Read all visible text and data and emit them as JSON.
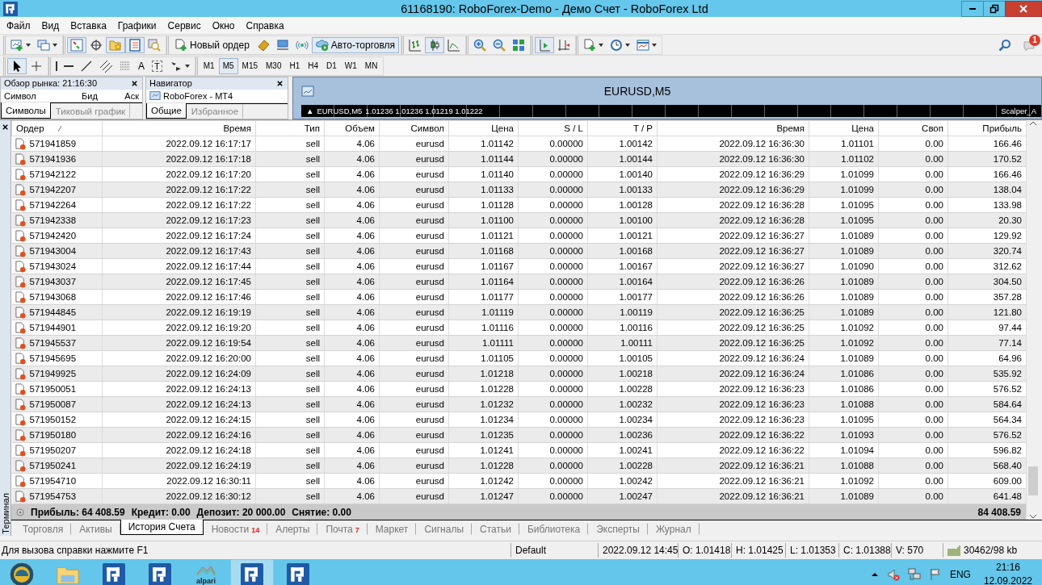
{
  "window": {
    "title": "61168190: RoboForex-Demo - Демо Счет - RoboForex Ltd"
  },
  "menu": [
    "Файл",
    "Вид",
    "Вставка",
    "Графики",
    "Сервис",
    "Окно",
    "Справка"
  ],
  "toolbar": [
    {
      "kind": "new-chart",
      "on": false,
      "dropdown": true
    },
    {
      "kind": "profiles",
      "on": false,
      "dropdown": true
    },
    {
      "kind": "separator"
    },
    {
      "kind": "market-watch",
      "on": true
    },
    {
      "kind": "data-window",
      "on": false
    },
    {
      "kind": "navigator",
      "on": true
    },
    {
      "kind": "terminal",
      "on": true
    },
    {
      "kind": "tester",
      "on": false
    },
    {
      "kind": "separator"
    },
    {
      "kind": "new-order",
      "label": "Новый ордер",
      "on": false
    },
    {
      "kind": "editor",
      "on": false
    },
    {
      "kind": "community",
      "on": false
    },
    {
      "kind": "signals",
      "on": false
    },
    {
      "kind": "autotrading",
      "label": "Авто-торговля",
      "on": true
    },
    {
      "kind": "separator"
    },
    {
      "kind": "bars",
      "on": false
    },
    {
      "kind": "candles",
      "on": true
    },
    {
      "kind": "line",
      "on": false
    },
    {
      "kind": "separator"
    },
    {
      "kind": "zoom-in",
      "on": false
    },
    {
      "kind": "zoom-out",
      "on": false
    },
    {
      "kind": "tile",
      "on": false
    },
    {
      "kind": "separator"
    },
    {
      "kind": "autoscroll",
      "on": true
    },
    {
      "kind": "shift",
      "on": false
    },
    {
      "kind": "separator"
    },
    {
      "kind": "indicators",
      "on": false,
      "dropdown": true
    },
    {
      "kind": "periods",
      "on": false,
      "dropdown": true
    },
    {
      "kind": "templates",
      "on": false,
      "dropdown": true
    }
  ],
  "notifications": {
    "count": "1"
  },
  "drawing_toolbar": [
    {
      "kind": "cursor",
      "on": true
    },
    {
      "kind": "crosshair",
      "on": false
    },
    {
      "kind": "separator"
    },
    {
      "kind": "vertical-line",
      "on": false
    },
    {
      "kind": "horizontal-line",
      "on": false
    },
    {
      "kind": "trend-line",
      "on": false
    },
    {
      "kind": "channel",
      "on": false
    },
    {
      "kind": "fibonacci",
      "on": false
    },
    {
      "kind": "text",
      "label": "A",
      "on": false
    },
    {
      "kind": "text-label",
      "label": "T",
      "on": false
    },
    {
      "kind": "arrows",
      "on": false,
      "dropdown": true
    }
  ],
  "timeframes": [
    {
      "label": "M1",
      "selected": false
    },
    {
      "label": "M5",
      "selected": true
    },
    {
      "label": "M15",
      "selected": false
    },
    {
      "label": "M30",
      "selected": false
    },
    {
      "label": "H1",
      "selected": false
    },
    {
      "label": "H4",
      "selected": false
    },
    {
      "label": "D1",
      "selected": false
    },
    {
      "label": "W1",
      "selected": false
    },
    {
      "label": "MN",
      "selected": false
    }
  ],
  "market_watch": {
    "title": "Обзор рынка: 21:16:30",
    "columns": [
      "Символ",
      "Бид",
      "Аск"
    ],
    "tabs": [
      {
        "label": "Символы",
        "selected": true
      },
      {
        "label": "Тиковый график",
        "selected": false
      }
    ]
  },
  "navigator": {
    "title": "Навигатор",
    "items": [
      {
        "label": "RoboForex - MT4"
      }
    ],
    "tabs": [
      {
        "label": "Общие",
        "selected": true
      },
      {
        "label": "Избранное",
        "selected": false
      }
    ]
  },
  "chart": {
    "title": "EURUSD,M5",
    "marker": "▲",
    "symbol": "EURUSD,M5",
    "ohlc": "1.01236 1.01236 1.01219 1.01222",
    "indicator": "Scalper_A"
  },
  "terminal": {
    "label": "Терминал",
    "columns": [
      "Ордер",
      "Время",
      "Тип",
      "Объем",
      "Символ",
      "Цена",
      "S / L",
      "T / P",
      "Время",
      "Цена",
      "Своп",
      "Прибыль"
    ],
    "rows": [
      {
        "cells": [
          "571941859",
          "2022.09.12 16:17:17",
          "sell",
          "4.06",
          "eurusd",
          "1.01142",
          "0.00000",
          "1.00142",
          "2022.09.12 16:36:30",
          "1.01101",
          "0.00",
          "166.46"
        ]
      },
      {
        "cells": [
          "571941936",
          "2022.09.12 16:17:18",
          "sell",
          "4.06",
          "eurusd",
          "1.01144",
          "0.00000",
          "1.00144",
          "2022.09.12 16:36:30",
          "1.01102",
          "0.00",
          "170.52"
        ]
      },
      {
        "cells": [
          "571942122",
          "2022.09.12 16:17:20",
          "sell",
          "4.06",
          "eurusd",
          "1.01140",
          "0.00000",
          "1.00140",
          "2022.09.12 16:36:29",
          "1.01099",
          "0.00",
          "166.46"
        ]
      },
      {
        "cells": [
          "571942207",
          "2022.09.12 16:17:22",
          "sell",
          "4.06",
          "eurusd",
          "1.01133",
          "0.00000",
          "1.00133",
          "2022.09.12 16:36:29",
          "1.01099",
          "0.00",
          "138.04"
        ]
      },
      {
        "cells": [
          "571942264",
          "2022.09.12 16:17:22",
          "sell",
          "4.06",
          "eurusd",
          "1.01128",
          "0.00000",
          "1.00128",
          "2022.09.12 16:36:28",
          "1.01095",
          "0.00",
          "133.98"
        ]
      },
      {
        "cells": [
          "571942338",
          "2022.09.12 16:17:23",
          "sell",
          "4.06",
          "eurusd",
          "1.01100",
          "0.00000",
          "1.00100",
          "2022.09.12 16:36:28",
          "1.01095",
          "0.00",
          "20.30"
        ]
      },
      {
        "cells": [
          "571942420",
          "2022.09.12 16:17:24",
          "sell",
          "4.06",
          "eurusd",
          "1.01121",
          "0.00000",
          "1.00121",
          "2022.09.12 16:36:27",
          "1.01089",
          "0.00",
          "129.92"
        ]
      },
      {
        "cells": [
          "571943004",
          "2022.09.12 16:17:43",
          "sell",
          "4.06",
          "eurusd",
          "1.01168",
          "0.00000",
          "1.00168",
          "2022.09.12 16:36:27",
          "1.01089",
          "0.00",
          "320.74"
        ]
      },
      {
        "cells": [
          "571943024",
          "2022.09.12 16:17:44",
          "sell",
          "4.06",
          "eurusd",
          "1.01167",
          "0.00000",
          "1.00167",
          "2022.09.12 16:36:27",
          "1.01090",
          "0.00",
          "312.62"
        ]
      },
      {
        "cells": [
          "571943037",
          "2022.09.12 16:17:45",
          "sell",
          "4.06",
          "eurusd",
          "1.01164",
          "0.00000",
          "1.00164",
          "2022.09.12 16:36:26",
          "1.01089",
          "0.00",
          "304.50"
        ]
      },
      {
        "cells": [
          "571943068",
          "2022.09.12 16:17:46",
          "sell",
          "4.06",
          "eurusd",
          "1.01177",
          "0.00000",
          "1.00177",
          "2022.09.12 16:36:26",
          "1.01089",
          "0.00",
          "357.28"
        ]
      },
      {
        "cells": [
          "571944845",
          "2022.09.12 16:19:19",
          "sell",
          "4.06",
          "eurusd",
          "1.01119",
          "0.00000",
          "1.00119",
          "2022.09.12 16:36:25",
          "1.01089",
          "0.00",
          "121.80"
        ]
      },
      {
        "cells": [
          "571944901",
          "2022.09.12 16:19:20",
          "sell",
          "4.06",
          "eurusd",
          "1.01116",
          "0.00000",
          "1.00116",
          "2022.09.12 16:36:25",
          "1.01092",
          "0.00",
          "97.44"
        ]
      },
      {
        "cells": [
          "571945537",
          "2022.09.12 16:19:54",
          "sell",
          "4.06",
          "eurusd",
          "1.01111",
          "0.00000",
          "1.00111",
          "2022.09.12 16:36:25",
          "1.01092",
          "0.00",
          "77.14"
        ]
      },
      {
        "cells": [
          "571945695",
          "2022.09.12 16:20:00",
          "sell",
          "4.06",
          "eurusd",
          "1.01105",
          "0.00000",
          "1.00105",
          "2022.09.12 16:36:24",
          "1.01089",
          "0.00",
          "64.96"
        ]
      },
      {
        "cells": [
          "571949925",
          "2022.09.12 16:24:09",
          "sell",
          "4.06",
          "eurusd",
          "1.01218",
          "0.00000",
          "1.00218",
          "2022.09.12 16:36:24",
          "1.01086",
          "0.00",
          "535.92"
        ]
      },
      {
        "cells": [
          "571950051",
          "2022.09.12 16:24:13",
          "sell",
          "4.06",
          "eurusd",
          "1.01228",
          "0.00000",
          "1.00228",
          "2022.09.12 16:36:23",
          "1.01086",
          "0.00",
          "576.52"
        ]
      },
      {
        "cells": [
          "571950087",
          "2022.09.12 16:24:13",
          "sell",
          "4.06",
          "eurusd",
          "1.01232",
          "0.00000",
          "1.00232",
          "2022.09.12 16:36:23",
          "1.01088",
          "0.00",
          "584.64"
        ]
      },
      {
        "cells": [
          "571950152",
          "2022.09.12 16:24:15",
          "sell",
          "4.06",
          "eurusd",
          "1.01234",
          "0.00000",
          "1.00234",
          "2022.09.12 16:36:23",
          "1.01095",
          "0.00",
          "564.34"
        ]
      },
      {
        "cells": [
          "571950180",
          "2022.09.12 16:24:16",
          "sell",
          "4.06",
          "eurusd",
          "1.01235",
          "0.00000",
          "1.00236",
          "2022.09.12 16:36:22",
          "1.01093",
          "0.00",
          "576.52"
        ]
      },
      {
        "cells": [
          "571950207",
          "2022.09.12 16:24:18",
          "sell",
          "4.06",
          "eurusd",
          "1.01241",
          "0.00000",
          "1.00241",
          "2022.09.12 16:36:22",
          "1.01094",
          "0.00",
          "596.82"
        ]
      },
      {
        "cells": [
          "571950241",
          "2022.09.12 16:24:19",
          "sell",
          "4.06",
          "eurusd",
          "1.01228",
          "0.00000",
          "1.00228",
          "2022.09.12 16:36:21",
          "1.01088",
          "0.00",
          "568.40"
        ]
      },
      {
        "cells": [
          "571954710",
          "2022.09.12 16:30:11",
          "sell",
          "4.06",
          "eurusd",
          "1.01242",
          "0.00000",
          "1.00242",
          "2022.09.12 16:36:21",
          "1.01092",
          "0.00",
          "609.00"
        ]
      },
      {
        "cells": [
          "571954753",
          "2022.09.12 16:30:12",
          "sell",
          "4.06",
          "eurusd",
          "1.01247",
          "0.00000",
          "1.00247",
          "2022.09.12 16:36:21",
          "1.01089",
          "0.00",
          "641.48"
        ]
      }
    ],
    "summary": {
      "items": [
        "Прибыль: 64 408.59",
        "Кредит: 0.00",
        "Депозит: 20 000.00",
        "Снятие: 0.00"
      ],
      "total": "84 408.59"
    },
    "tabs": [
      {
        "label": "Торговля",
        "selected": false
      },
      {
        "label": "Активы",
        "selected": false
      },
      {
        "label": "История Счета",
        "selected": true
      },
      {
        "label": "Новости",
        "badge": "14",
        "selected": false
      },
      {
        "label": "Алерты",
        "selected": false
      },
      {
        "label": "Почта",
        "badge": "7",
        "selected": false
      },
      {
        "label": "Маркет",
        "selected": false
      },
      {
        "label": "Сигналы",
        "selected": false
      },
      {
        "label": "Статьи",
        "selected": false
      },
      {
        "label": "Библиотека",
        "selected": false
      },
      {
        "label": "Эксперты",
        "selected": false
      },
      {
        "label": "Журнал",
        "selected": false
      }
    ]
  },
  "status_bar": {
    "help": "Для вызова справки нажмите F1",
    "profile": "Default",
    "time": "2022.09.12 14:45",
    "open": "O: 1.01418",
    "high": "H: 1.01425",
    "low": "L: 1.01353",
    "close": "C: 1.01388",
    "volume": "V: 570",
    "traffic": "30462/98 kb"
  },
  "taskbar": {
    "items": [
      {
        "kind": "start",
        "selected": false
      },
      {
        "kind": "explorer",
        "selected": false
      },
      {
        "kind": "app",
        "selected": false
      },
      {
        "kind": "app",
        "selected": false
      },
      {
        "kind": "alpari",
        "label": "alpari",
        "selected": false
      },
      {
        "kind": "app",
        "selected": true
      },
      {
        "kind": "app",
        "selected": false
      }
    ],
    "language": "ENG",
    "time": "21:16",
    "date": "12.09.2022"
  }
}
